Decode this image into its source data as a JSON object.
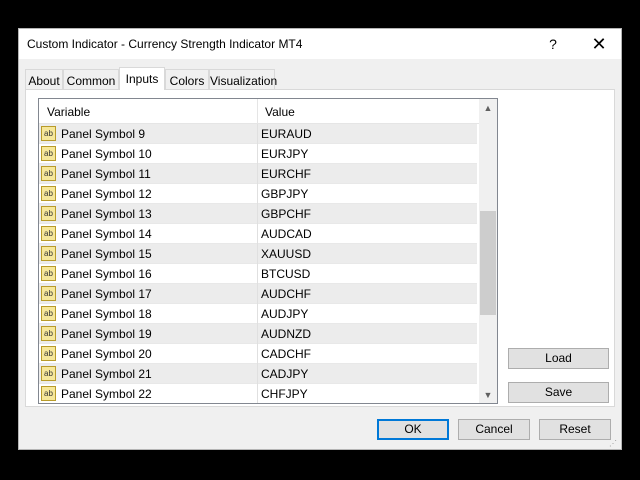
{
  "window": {
    "title": "Custom Indicator - Currency Strength Indicator MT4",
    "help_glyph": "?",
    "close_glyph": "✕"
  },
  "tabs": [
    {
      "label": "About"
    },
    {
      "label": "Common"
    },
    {
      "label": "Inputs",
      "active": true
    },
    {
      "label": "Colors"
    },
    {
      "label": "Visualization"
    }
  ],
  "grid": {
    "header_variable": "Variable",
    "header_value": "Value",
    "row_icon_text": "ab",
    "rows": [
      {
        "variable": "Panel Symbol 9",
        "value": "EURAUD"
      },
      {
        "variable": "Panel Symbol 10",
        "value": "EURJPY"
      },
      {
        "variable": "Panel Symbol 11",
        "value": "EURCHF"
      },
      {
        "variable": "Panel Symbol 12",
        "value": "GBPJPY"
      },
      {
        "variable": "Panel Symbol 13",
        "value": "GBPCHF"
      },
      {
        "variable": "Panel Symbol 14",
        "value": "AUDCAD"
      },
      {
        "variable": "Panel Symbol 15",
        "value": "XAUUSD"
      },
      {
        "variable": "Panel Symbol 16",
        "value": "BTCUSD"
      },
      {
        "variable": "Panel Symbol 17",
        "value": "AUDCHF"
      },
      {
        "variable": "Panel Symbol 18",
        "value": "AUDJPY"
      },
      {
        "variable": "Panel Symbol 19",
        "value": "AUDNZD"
      },
      {
        "variable": "Panel Symbol 20",
        "value": "CADCHF"
      },
      {
        "variable": "Panel Symbol 21",
        "value": "CADJPY"
      },
      {
        "variable": "Panel Symbol 22",
        "value": "CHFJPY"
      }
    ],
    "scroll_up_glyph": "▲",
    "scroll_down_glyph": "▼"
  },
  "side_buttons": {
    "load_label": "Load",
    "save_label": "Save"
  },
  "bottom_buttons": {
    "ok_label": "OK",
    "cancel_label": "Cancel",
    "reset_label": "Reset"
  }
}
